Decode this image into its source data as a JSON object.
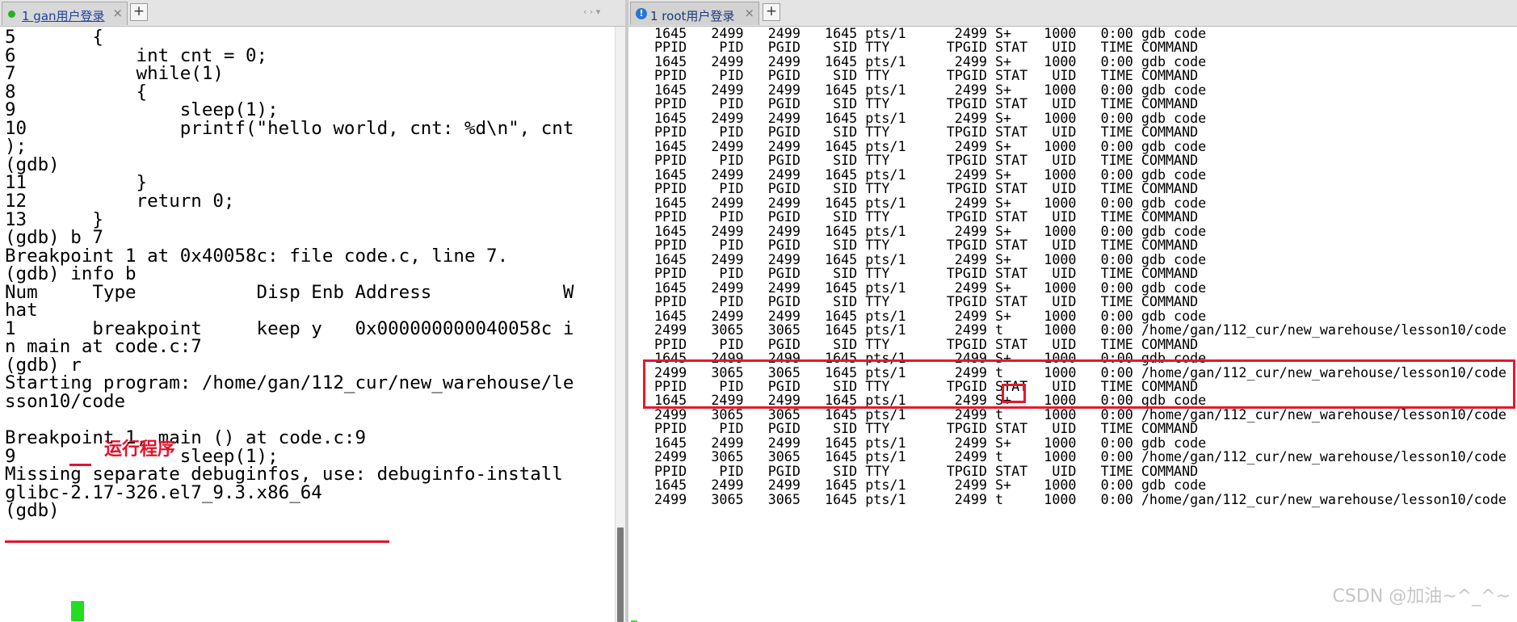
{
  "colors": {
    "accent_red": "#e3122c",
    "cursor_green": "#22dd22",
    "tab_dot_green": "#24b324",
    "info_blue": "#2a76d2"
  },
  "left_tab": {
    "label": "1 gan用户登录",
    "close": "×",
    "add": "+",
    "nav": "‹ › ▾",
    "status_icon": "green-dot-icon"
  },
  "right_tab": {
    "label": "1 root用户登录",
    "close": "×",
    "add": "+",
    "info_icon": "!"
  },
  "left_terminal": {
    "lines": [
      "5       {",
      "6           int cnt = 0;",
      "7           while(1)",
      "8           {",
      "9               sleep(1);",
      "10              printf(\"hello world, cnt: %d\\n\", cnt",
      ");",
      "(gdb)",
      "11          }",
      "12          return 0;",
      "13      }",
      "(gdb) b 7",
      "Breakpoint 1 at 0x40058c: file code.c, line 7.",
      "(gdb) info b",
      "Num     Type           Disp Enb Address            W",
      "hat",
      "1       breakpoint     keep y   0x000000000040058c i",
      "n main at code.c:7",
      "(gdb) r",
      "Starting program: /home/gan/112_cur/new_warehouse/le",
      "sson10/code",
      "",
      "Breakpoint 1, main () at code.c:9",
      "9               sleep(1);",
      "Missing separate debuginfos, use: debuginfo-install",
      "glibc-2.17-326.el7_9.3.x86_64",
      "(gdb) "
    ],
    "annotation": "运行程序"
  },
  "right_terminal": {
    "lines": [
      " 1645   2499   2499   1645 pts/1      2499 S+    1000   0:00 gdb code",
      " PPID    PID   PGID    SID TTY       TPGID STAT   UID   TIME COMMAND",
      " 1645   2499   2499   1645 pts/1      2499 S+    1000   0:00 gdb code",
      " PPID    PID   PGID    SID TTY       TPGID STAT   UID   TIME COMMAND",
      " 1645   2499   2499   1645 pts/1      2499 S+    1000   0:00 gdb code",
      " PPID    PID   PGID    SID TTY       TPGID STAT   UID   TIME COMMAND",
      " 1645   2499   2499   1645 pts/1      2499 S+    1000   0:00 gdb code",
      " PPID    PID   PGID    SID TTY       TPGID STAT   UID   TIME COMMAND",
      " 1645   2499   2499   1645 pts/1      2499 S+    1000   0:00 gdb code",
      " PPID    PID   PGID    SID TTY       TPGID STAT   UID   TIME COMMAND",
      " 1645   2499   2499   1645 pts/1      2499 S+    1000   0:00 gdb code",
      " PPID    PID   PGID    SID TTY       TPGID STAT   UID   TIME COMMAND",
      " 1645   2499   2499   1645 pts/1      2499 S+    1000   0:00 gdb code",
      " PPID    PID   PGID    SID TTY       TPGID STAT   UID   TIME COMMAND",
      " 1645   2499   2499   1645 pts/1      2499 S+    1000   0:00 gdb code",
      " PPID    PID   PGID    SID TTY       TPGID STAT   UID   TIME COMMAND",
      " 1645   2499   2499   1645 pts/1      2499 S+    1000   0:00 gdb code",
      " PPID    PID   PGID    SID TTY       TPGID STAT   UID   TIME COMMAND",
      " 1645   2499   2499   1645 pts/1      2499 S+    1000   0:00 gdb code",
      " PPID    PID   PGID    SID TTY       TPGID STAT   UID   TIME COMMAND",
      " 1645   2499   2499   1645 pts/1      2499 S+    1000   0:00 gdb code",
      " 2499   3065   3065   1645 pts/1      2499 t     1000   0:00 /home/gan/112_cur/new_warehouse/lesson10/code",
      " PPID    PID   PGID    SID TTY       TPGID STAT   UID   TIME COMMAND",
      " 1645   2499   2499   1645 pts/1      2499 S+    1000   0:00 gdb code",
      " 2499   3065   3065   1645 pts/1      2499 t     1000   0:00 /home/gan/112_cur/new_warehouse/lesson10/code",
      " PPID    PID   PGID    SID TTY       TPGID STAT   UID   TIME COMMAND",
      " 1645   2499   2499   1645 pts/1      2499 S+    1000   0:00 gdb code",
      " 2499   3065   3065   1645 pts/1      2499 t     1000   0:00 /home/gan/112_cur/new_warehouse/lesson10/code",
      " PPID    PID   PGID    SID TTY       TPGID STAT   UID   TIME COMMAND",
      " 1645   2499   2499   1645 pts/1      2499 S+    1000   0:00 gdb code",
      " 2499   3065   3065   1645 pts/1      2499 t     1000   0:00 /home/gan/112_cur/new_warehouse/lesson10/code",
      " PPID    PID   PGID    SID TTY       TPGID STAT   UID   TIME COMMAND",
      " 1645   2499   2499   1645 pts/1      2499 S+    1000   0:00 gdb code",
      " 2499   3065   3065   1645 pts/1      2499 t     1000   0:00 /home/gan/112_cur/new_warehouse/lesson10/code"
    ]
  },
  "watermark": "CSDN @加油~^_^~"
}
